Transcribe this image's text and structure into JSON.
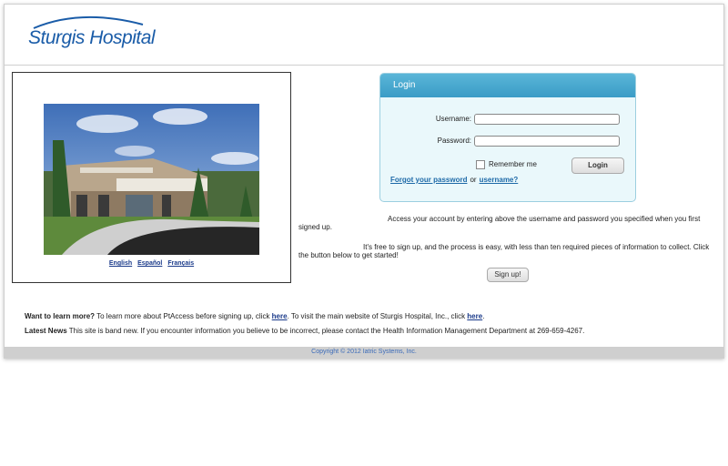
{
  "header": {
    "logo_text": "Sturgis Hospital"
  },
  "photo": {
    "languages": [
      "English",
      "Español",
      "Français"
    ]
  },
  "login": {
    "title": "Login",
    "username_label": "Username:",
    "password_label": "Password:",
    "username_value": "",
    "password_value": "",
    "remember_label": "Remember me",
    "login_button": "Login",
    "forgot_password": "Forgot your password",
    "or": "or",
    "forgot_username": "username?"
  },
  "info": {
    "access_text": "Access your account by entering above the username and password you specified when you first signed up.",
    "free_text": "It's free to sign up, and the process is easy, with less than ten required pieces of information to collect. Click the button below to get started!",
    "signup_button": "Sign up!"
  },
  "bottom": {
    "learn_heading": "Want to learn more?",
    "learn_text1": " To learn more about PtAccess before signing up, click ",
    "learn_link1": "here",
    "learn_text2": ". To visit the main website of Sturgis Hospital, Inc., click ",
    "learn_link2": "here",
    "learn_text3": ".",
    "news_heading": "Latest News",
    "news_text": " This site is band new. If you encounter information you believe to be incorrect, please contact the Health Information Management Department at 269-659-4267."
  },
  "footer": {
    "copyright": "Copyright © 2012 Iatric Systems, Inc."
  },
  "colors": {
    "brand": "#1a5ca8",
    "login_header": "#3a9cc6",
    "login_bg": "#eaf8fb"
  }
}
